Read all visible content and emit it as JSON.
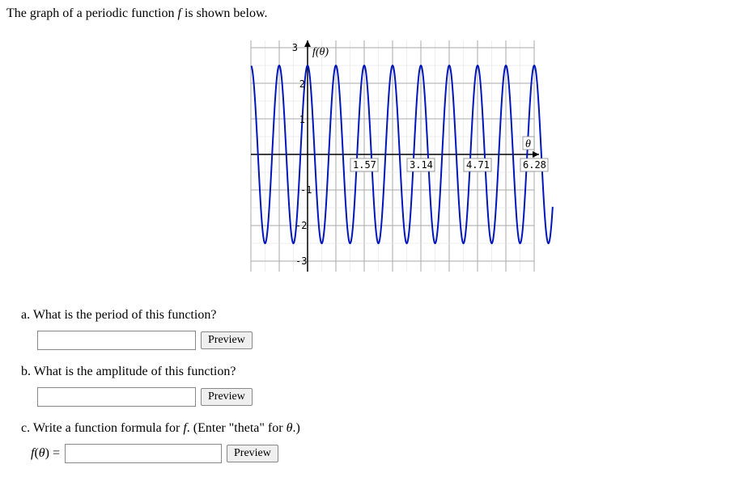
{
  "intro_prefix": "The graph of a periodic function ",
  "intro_f": "f",
  "intro_suffix": " is shown below.",
  "questions": {
    "a": {
      "label": "a. What is the period of this function?",
      "preview": "Preview"
    },
    "b": {
      "label": "b. What is the amplitude of this function?",
      "preview": "Preview"
    },
    "c": {
      "prefix": "c. Write a function formula for ",
      "f": "f",
      "middle": ". (Enter \"theta\" for ",
      "theta": "θ",
      "suffix": ".)",
      "lhs_f": "f",
      "lhs_open": "(",
      "lhs_theta": "θ",
      "lhs_close": ") =",
      "preview": "Preview"
    }
  },
  "chart_data": {
    "type": "line",
    "title": "",
    "xlabel": "θ",
    "ylabel": "f(θ)",
    "xlim": [
      -1.57,
      7.0
    ],
    "ylim": [
      -3.5,
      3.5
    ],
    "x_ticks": [
      1.57,
      3.14,
      4.71,
      6.28
    ],
    "y_ticks": [
      -3,
      -2,
      -1,
      1,
      2,
      3
    ],
    "amplitude": 2.5,
    "midline": 0,
    "period": 0.785,
    "phase_shift": 0,
    "function": "2.5*cos(8*theta)"
  }
}
